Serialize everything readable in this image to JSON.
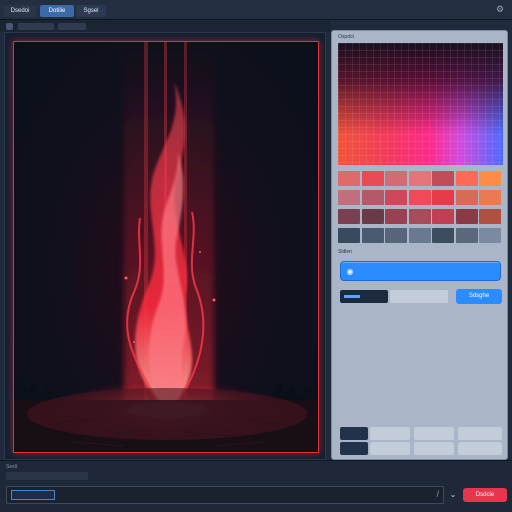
{
  "tabs": [
    "Dsedoi",
    "Dotilie",
    "Sgsel"
  ],
  "panel": {
    "title": "Ospdct",
    "section_label": "Sldlen",
    "apply_label": "Sdsghe"
  },
  "bottom": {
    "label": "Seslt",
    "submit_label": "Dsdcle"
  },
  "swatch_colors": [
    [
      "#e06a6a",
      "#e84a56",
      "#d46a74",
      "#e7737a",
      "#c24d58",
      "#ff6a56",
      "#ff8c46"
    ],
    [
      "#c0707c",
      "#b05a6a",
      "#d0465a",
      "#f04a5a",
      "#e73a4a",
      "#d66c58",
      "#ea7a54"
    ],
    [
      "#7a4052",
      "#6a3a48",
      "#9a4050",
      "#a84c5a",
      "#c04052",
      "#8a3a44",
      "#b05042"
    ],
    [
      "#3a4a5e",
      "#4a5a70",
      "#56657a",
      "#6a7890",
      "#3e4c60",
      "#5a687e",
      "#7a8aa0"
    ]
  ],
  "colors": {
    "accent": "#2a8cff",
    "submit": "#e8344c",
    "canvas_border": "#e0303a"
  },
  "icons": [
    "gear-icon",
    "swatch-icon",
    "chevron-down-icon",
    "slash-icon"
  ]
}
